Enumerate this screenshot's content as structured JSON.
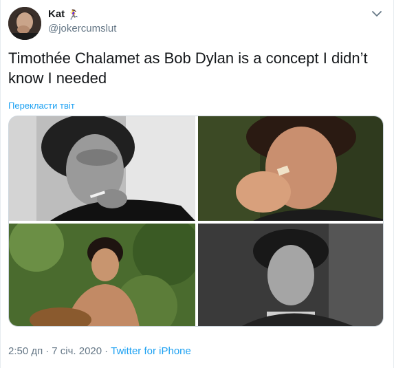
{
  "user": {
    "display_name": "Kat",
    "name_emoji": "🏃‍♀️",
    "handle": "@jokercumslut"
  },
  "tweet": {
    "text": "Timothée Chalamet as Bob Dylan is a concept I didn’t know I needed",
    "translate_label": "Перекласти твіт"
  },
  "media": {
    "photos": [
      {
        "name": "photo-1",
        "icon": "photo"
      },
      {
        "name": "photo-2",
        "icon": "photo"
      },
      {
        "name": "photo-3",
        "icon": "photo"
      },
      {
        "name": "photo-4",
        "icon": "photo"
      }
    ]
  },
  "meta": {
    "time": "2:50 дп",
    "separator": "·",
    "date": "7 січ. 2020",
    "separator2": "·",
    "source": "Twitter for iPhone"
  },
  "colors": {
    "accent": "#1da1f2",
    "secondary_text": "#657786",
    "primary_text": "#14171a"
  }
}
